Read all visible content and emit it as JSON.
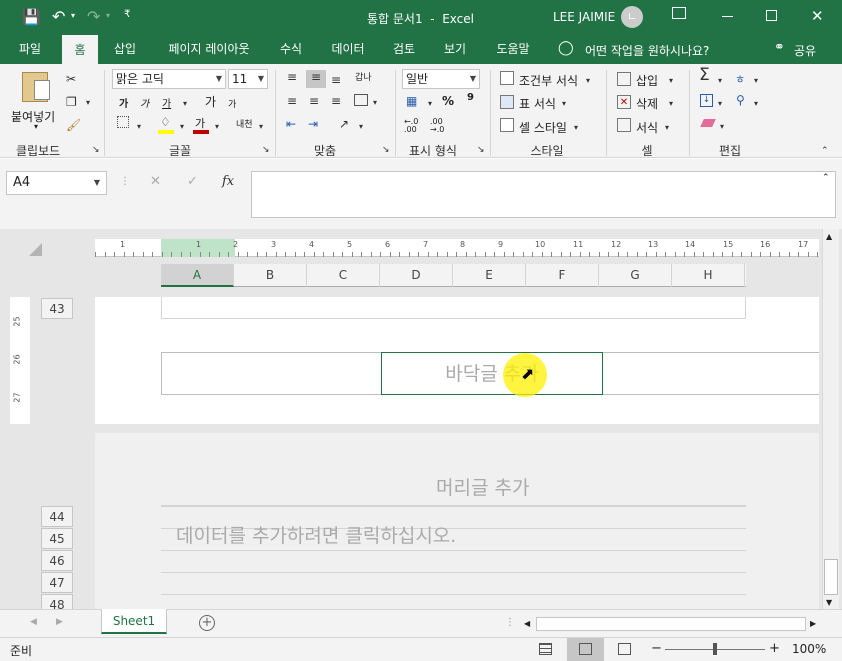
{
  "titlebar": {
    "doc_title": "통합 문서1  -  Excel",
    "user_name": "LEE JAIMIE",
    "avatar_initial": "ㄴ"
  },
  "tabs": [
    "파일",
    "홈",
    "삽입",
    "페이지 레이아웃",
    "수식",
    "데이터",
    "검토",
    "보기",
    "도움말"
  ],
  "tell_me": "어떤 작업을 원하시나요?",
  "share": "공유",
  "ribbon": {
    "clipboard": {
      "paste": "붙여넣기",
      "label": "클립보드"
    },
    "font": {
      "name": "맑은 고딕",
      "size": "11",
      "label": "글꼴",
      "bold": "가",
      "italic": "가",
      "underline": "가",
      "grow": "가",
      "shrink": "가",
      "phonetic": "내천",
      "fill_letter": "가"
    },
    "align": {
      "label": "맞춤",
      "wrap": "갑나"
    },
    "number": {
      "format": "일반",
      "label": "표시 형식",
      "percent": "%",
      "comma": "9",
      "inc_dec": "←.0 .00",
      "dec_dec": ".00 →.0"
    },
    "styles": {
      "conditional": "조건부 서식",
      "table": "표 서식",
      "cell": "셀 스타일",
      "label": "스타일"
    },
    "cells": {
      "insert": "삽입",
      "delete": "삭제",
      "format": "서식",
      "label": "셀"
    },
    "editing": {
      "label": "편집",
      "sort_letter": "ㅎ"
    }
  },
  "formula_bar": {
    "name_box": "A4",
    "cancel": "✕",
    "enter": "✓",
    "fx": "fx",
    "value": ""
  },
  "columns": [
    "A",
    "B",
    "C",
    "D",
    "E",
    "F",
    "G",
    "H"
  ],
  "selected_column": "A",
  "ruler_numbers": [
    "1",
    "1",
    "2",
    "3",
    "4",
    "5",
    "6",
    "7",
    "8",
    "9",
    "10",
    "11",
    "12",
    "13",
    "14",
    "15",
    "16",
    "17"
  ],
  "vruler_numbers": [
    "25",
    "26",
    "27"
  ],
  "page1": {
    "row_label": "43",
    "footer_placeholder": "바닥글 추가"
  },
  "page2": {
    "header_placeholder": "머리글 추가",
    "data_placeholder": "데이터를 추가하려면 클릭하십시오.",
    "rows": [
      "44",
      "45",
      "46",
      "47",
      "48"
    ]
  },
  "sheet_tab": "Sheet1",
  "status": {
    "ready": "준비",
    "zoom": "100%",
    "minus": "−",
    "plus": "+"
  },
  "colors": {
    "excel_green": "#217346",
    "highlight": "#ffff00",
    "font_red": "#c00000"
  }
}
